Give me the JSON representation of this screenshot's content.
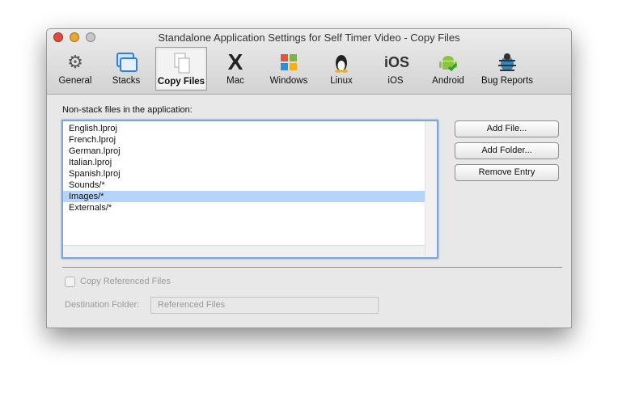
{
  "window": {
    "title": "Standalone Application Settings for Self Timer Video - Copy Files"
  },
  "toolbar": [
    {
      "label": "General",
      "icon": "gear-icon"
    },
    {
      "label": "Stacks",
      "icon": "stacks-icon"
    },
    {
      "label": "Copy Files",
      "icon": "copy-files-icon",
      "selected": true
    },
    {
      "label": "Mac",
      "icon": "mac-x-icon"
    },
    {
      "label": "Windows",
      "icon": "windows-icon"
    },
    {
      "label": "Linux",
      "icon": "linux-penguin-icon"
    },
    {
      "label": "iOS",
      "icon": "ios-icon",
      "glyph": "iOS"
    },
    {
      "label": "Android",
      "icon": "android-icon"
    },
    {
      "label": "Bug Reports",
      "icon": "bug-icon"
    }
  ],
  "main": {
    "list_label": "Non-stack files in the application:",
    "files": [
      "English.lproj",
      "French.lproj",
      "German.lproj",
      "Italian.lproj",
      "Spanish.lproj",
      "Sounds/*",
      "Images/*",
      "Externals/*"
    ],
    "selected_index": 6,
    "buttons": {
      "add_file": "Add File...",
      "add_folder": "Add Folder...",
      "remove_entry": "Remove Entry"
    },
    "copy_referenced": {
      "label": "Copy Referenced Files",
      "checked": false
    },
    "destination": {
      "label": "Destination Folder:",
      "value": "Referenced Files"
    }
  }
}
